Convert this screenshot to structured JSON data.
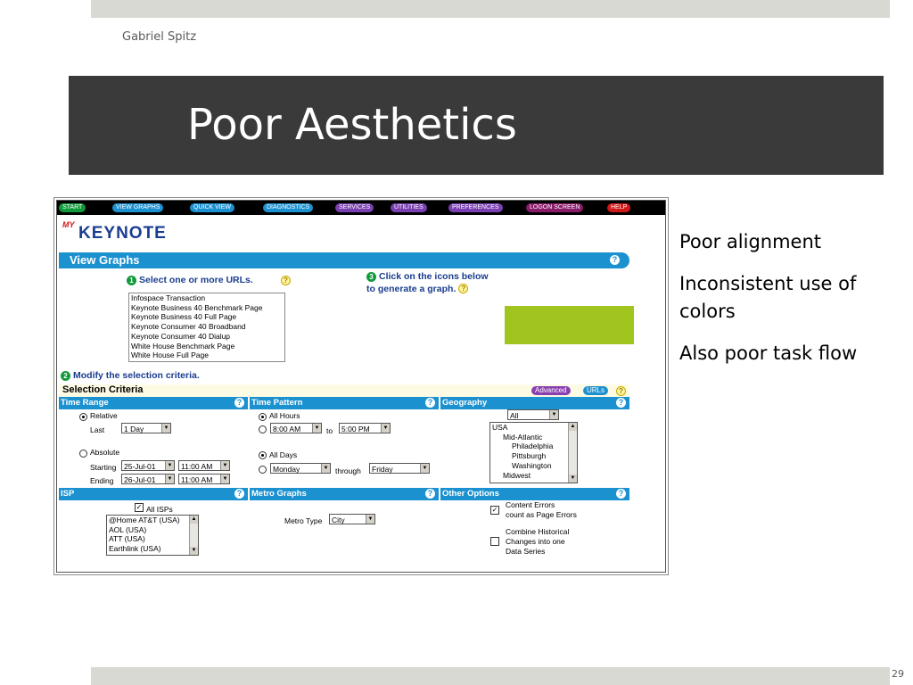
{
  "slide": {
    "author": "Gabriel Spitz",
    "title": "Poor Aesthetics",
    "page_number": "29",
    "bullets": [
      "Poor alignment",
      "Inconsistent use of colors",
      "Also poor task flow"
    ]
  },
  "screenshot": {
    "nav": [
      {
        "label": "START",
        "color": "#119a3a"
      },
      {
        "label": "VIEW GRAPHS",
        "color": "#1c91d0"
      },
      {
        "label": "QUICK VIEW",
        "color": "#1c91d0"
      },
      {
        "label": "DIAGNOSTICS",
        "color": "#1c91d0"
      },
      {
        "label": "SERVICES",
        "color": "#7a3fb0"
      },
      {
        "label": "UTILITIES",
        "color": "#7a3fb0"
      },
      {
        "label": "PREFERENCES",
        "color": "#7a3fb0"
      },
      {
        "label": "LOGON SCREEN",
        "color": "#8a1a6a"
      },
      {
        "label": "HELP",
        "color": "#d01818"
      }
    ],
    "logo_my": "MY",
    "logo_brand": "KEYNOTE",
    "view_graphs_title": "View Graphs",
    "step1_num": "1",
    "step1_text": "Select one or more URLs.",
    "step3_num": "3",
    "step3_line1": "Click on the icons below",
    "step3_line2": "to generate a graph.",
    "urls": [
      "Infospace  Transaction",
      "Keynote Business 40 Benchmark Page",
      "Keynote Business 40 Full Page",
      "Keynote Consumer 40 Broadband",
      "Keynote Consumer 40 Dialup",
      "White House Benchmark Page",
      "White House Full Page"
    ],
    "step2_num": "2",
    "step2_text": "Modify the selection criteria.",
    "selection_criteria": "Selection Criteria",
    "advanced": "Advanced",
    "urls_btn": "URLs",
    "time_range": {
      "header": "Time Range",
      "relative": "Relative",
      "last": "Last",
      "last_value": "1 Day",
      "absolute": "Absolute",
      "starting": "Starting",
      "start_date": "25-Jul-01",
      "start_time": "11:00 AM",
      "ending": "Ending",
      "end_date": "26-Jul-01",
      "end_time": "11:00 AM"
    },
    "time_pattern": {
      "header": "Time Pattern",
      "all_hours": "All Hours",
      "from_time": "8:00 AM",
      "to": "to",
      "to_time": "5:00 PM",
      "all_days": "All Days",
      "from_day": "Monday",
      "through": "through",
      "to_day": "Friday"
    },
    "geography": {
      "header": "Geography",
      "filter": "All",
      "items": [
        "USA",
        "Mid-Atlantic",
        "Philadelphia",
        "Pittsburgh",
        "Washington",
        "Midwest"
      ]
    },
    "isp": {
      "header": "ISP",
      "all_isps": "All ISPs",
      "items": [
        "@Home AT&T (USA)",
        "AOL (USA)",
        "ATT (USA)",
        "Earthlink (USA)"
      ]
    },
    "metro": {
      "header": "Metro Graphs",
      "metro_type": "Metro Type",
      "metro_value": "City"
    },
    "other": {
      "header": "Other Options",
      "opt1_line1": "Content Errors",
      "opt1_line2": "count as Page Errors",
      "opt2_line1": "Combine Historical",
      "opt2_line2": "Changes into one",
      "opt2_line3": "Data Series"
    },
    "help": "?"
  }
}
